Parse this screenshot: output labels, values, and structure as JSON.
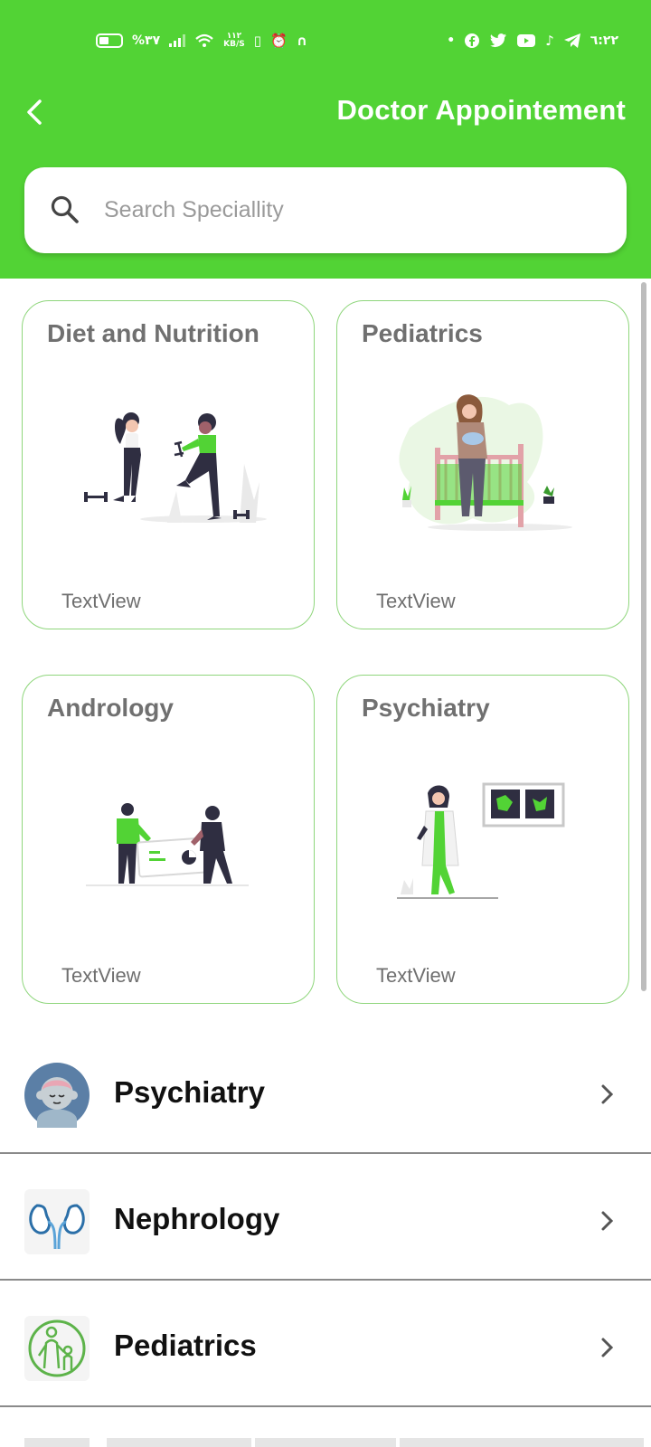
{
  "status_bar": {
    "battery": "%٣٧",
    "net_speed_value": "١١٢",
    "net_speed_unit": "KB/S",
    "time": "٦:٢٢"
  },
  "header": {
    "title": "Doctor Appointement",
    "background": "#52d335"
  },
  "search": {
    "placeholder": "Search Speciallity"
  },
  "cards": [
    {
      "title": "Diet and Nutrition",
      "subtitle": "TextView"
    },
    {
      "title": "Pediatrics",
      "subtitle": "TextView"
    },
    {
      "title": "Andrology",
      "subtitle": "TextView"
    },
    {
      "title": "Psychiatry",
      "subtitle": "TextView"
    }
  ],
  "list": [
    {
      "label": "Psychiatry",
      "icon": "brain-avatar-icon"
    },
    {
      "label": "Nephrology",
      "icon": "kidneys-icon"
    },
    {
      "label": "Pediatrics",
      "icon": "parent-child-icon"
    }
  ],
  "colors": {
    "accent": "#52d335",
    "card_border": "#8fd67c"
  }
}
